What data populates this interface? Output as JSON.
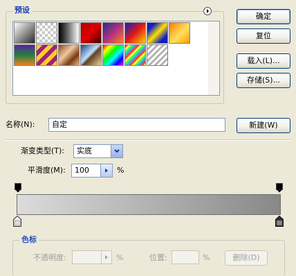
{
  "presets": {
    "title": "预设",
    "swatches": [
      {
        "name": "black-white-swatch",
        "bg": "linear-gradient(135deg,#ffffff,#8a8a8a 55%,#2a2a2a)"
      },
      {
        "name": "checker-transparent-swatch",
        "bg": "repeating-conic-gradient(#c8c8c8 0 25%,#ffffff 0 50%) 0 0/8px 8px"
      },
      {
        "name": "black-white-horizontal-swatch",
        "bg": "linear-gradient(90deg,#000000,#5a5a5a 40%,#ffffff)"
      },
      {
        "name": "red-dark-swatch",
        "bg": "linear-gradient(135deg,#b00000,#e00000 50%,#400000)"
      },
      {
        "name": "violet-orange-swatch",
        "bg": "linear-gradient(135deg,#20308a,#b03080 50%,#ff8020)"
      },
      {
        "name": "blue-red-yellow-swatch",
        "bg": "linear-gradient(135deg,#1020c0,#e01818 50%,#ffd000)"
      },
      {
        "name": "blue-yellow-blue-swatch",
        "bg": "linear-gradient(135deg,#1020c0 20%,#ffe000 50%,#1020c0 80%)"
      },
      {
        "name": "orange-yellow-swatch",
        "bg": "linear-gradient(135deg,#ff7a00,#ffe060 55%,#ff9a00)"
      },
      {
        "name": "violet-green-orange-swatch",
        "bg": "linear-gradient(180deg,#6020a0,#208040 50%,#f08020)"
      },
      {
        "name": "yellow-violet-stripes-swatch",
        "bg": "repeating-linear-gradient(135deg,#ffd020 0 6px,#a02080 6px 12px)"
      },
      {
        "name": "copper-swatch",
        "bg": "linear-gradient(135deg,#8a4a20,#f0c8a0 40%,#7a3a10 70%,#e8b890)"
      },
      {
        "name": "chrome-swatch",
        "bg": "linear-gradient(135deg,#204080,#c0e0ff 45%,#604020 55%,#f0d0a0)"
      },
      {
        "name": "spectrum-swatch",
        "bg": "linear-gradient(135deg,#ff0000,#ffff00,#00ff00,#00ffff,#0000ff,#ff00ff)"
      },
      {
        "name": "transparent-rainbow-swatch",
        "bg": "repeating-linear-gradient(135deg,#ff4040 0 3px,#ffff40 3px 6px,#40ff40 6px 9px,#40a0ff 9px 12px)"
      },
      {
        "name": "transparent-stripes-swatch",
        "bg": "repeating-linear-gradient(135deg,#ffffff 0 3px,#b0b0b0 3px 6px)"
      }
    ]
  },
  "buttons": {
    "ok": "确定",
    "reset": "复位",
    "load": "载入(L)...",
    "save": "存储(S)...",
    "new": "新建(W)"
  },
  "name": {
    "label": "名称(N):",
    "value": "自定"
  },
  "gradient_type": {
    "label": "渐变类型(T):",
    "value": "实底"
  },
  "smoothness": {
    "label": "平滑度(M):",
    "value": "100",
    "unit": "%"
  },
  "gradient": {
    "from_color": "#dcdcdc",
    "to_color": "#888888"
  },
  "color_stops": {
    "title": "色标",
    "opacity_label": "不透明度:",
    "opacity_unit": "%",
    "location_label": "位置:",
    "location_unit": "%",
    "delete_button": "删除(D)"
  }
}
